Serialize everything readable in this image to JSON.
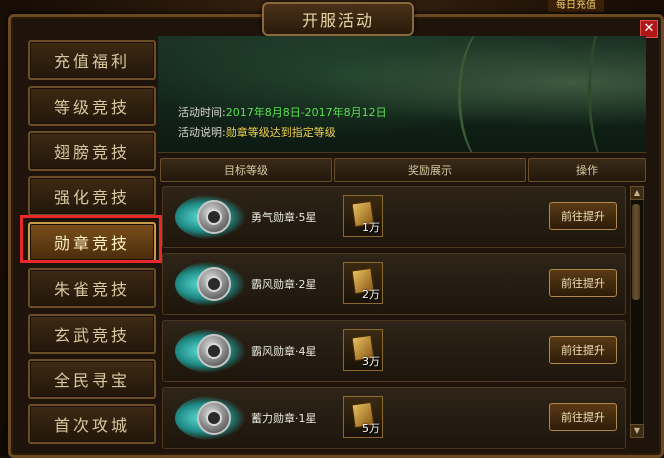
{
  "window": {
    "title": "开服活动",
    "top_badge": "每日充值",
    "close_glyph": "✕"
  },
  "sidebar": {
    "items": [
      {
        "label": "充值福利"
      },
      {
        "label": "等级竞技"
      },
      {
        "label": "翅膀竞技"
      },
      {
        "label": "强化竞技"
      },
      {
        "label": "勋章竞技",
        "active": true
      },
      {
        "label": "朱雀竞技"
      },
      {
        "label": "玄武竞技"
      },
      {
        "label": "全民寻宝"
      },
      {
        "label": "首次攻城"
      }
    ]
  },
  "banner": {
    "time_label": "活动时间:",
    "time_value": "2017年8月8日-2017年8月12日",
    "desc_label": "活动说明:",
    "desc_value": "勋章等级达到指定等级"
  },
  "table": {
    "headers": [
      "目标等级",
      "奖励展示",
      "操作"
    ],
    "rows": [
      {
        "medal": "勇气勋章·5星",
        "reward_amount": "1万",
        "action": "前往提升"
      },
      {
        "medal": "霸风勋章·2星",
        "reward_amount": "2万",
        "action": "前往提升"
      },
      {
        "medal": "霸风勋章·4星",
        "reward_amount": "3万",
        "action": "前往提升"
      },
      {
        "medal": "蓄力勋章·1星",
        "reward_amount": "5万",
        "action": "前往提升"
      }
    ]
  },
  "scrollbar": {
    "up_glyph": "▲",
    "down_glyph": "▼"
  },
  "colors": {
    "highlight": "#e8282a",
    "time_green": "#58e050",
    "desc_yellow": "#f0d050",
    "medal_glow": "#5fe0d8"
  }
}
